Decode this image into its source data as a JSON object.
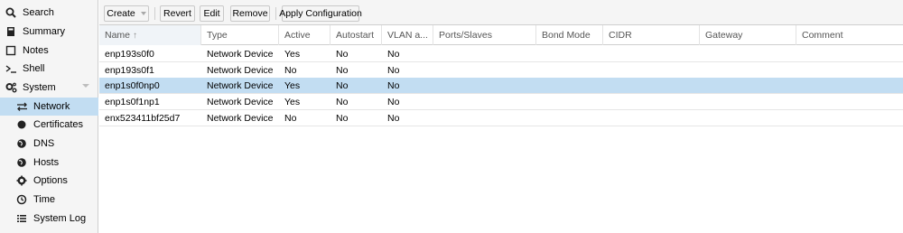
{
  "sidebar": {
    "items": [
      {
        "label": "Search",
        "icon": "search-icon"
      },
      {
        "label": "Summary",
        "icon": "book-icon"
      },
      {
        "label": "Notes",
        "icon": "note-icon"
      },
      {
        "label": "Shell",
        "icon": "terminal-icon"
      },
      {
        "label": "System",
        "icon": "gears-icon"
      },
      {
        "label": "Network",
        "icon": "exchange-icon"
      },
      {
        "label": "Certificates",
        "icon": "certificate-icon"
      },
      {
        "label": "DNS",
        "icon": "globe-icon"
      },
      {
        "label": "Hosts",
        "icon": "globe-icon"
      },
      {
        "label": "Options",
        "icon": "gear-icon"
      },
      {
        "label": "Time",
        "icon": "clock-icon"
      },
      {
        "label": "System Log",
        "icon": "list-icon"
      }
    ],
    "selected": "Network"
  },
  "toolbar": {
    "create": "Create",
    "revert": "Revert",
    "edit": "Edit",
    "remove": "Remove",
    "apply": "Apply Configuration"
  },
  "grid": {
    "columns": [
      "Name",
      "Type",
      "Active",
      "Autostart",
      "VLAN a...",
      "Ports/Slaves",
      "Bond Mode",
      "CIDR",
      "Gateway",
      "Comment"
    ],
    "sort_indicator": "↑",
    "rows": [
      [
        "enp193s0f0",
        "Network Device",
        "Yes",
        "No",
        "No",
        "",
        "",
        "",
        "",
        ""
      ],
      [
        "enp193s0f1",
        "Network Device",
        "No",
        "No",
        "No",
        "",
        "",
        "",
        "",
        ""
      ],
      [
        "enp1s0f0np0",
        "Network Device",
        "Yes",
        "No",
        "No",
        "",
        "",
        "",
        "",
        ""
      ],
      [
        "enp1s0f1np1",
        "Network Device",
        "Yes",
        "No",
        "No",
        "",
        "",
        "",
        "",
        ""
      ],
      [
        "enx523411bf25d7",
        "Network Device",
        "No",
        "No",
        "No",
        "",
        "",
        "",
        "",
        ""
      ]
    ],
    "selected_row": 2
  },
  "colors": {
    "selected": "#c2ddf2",
    "sidebar_bg": "#f5f5f5",
    "border": "#cfcfcf"
  }
}
